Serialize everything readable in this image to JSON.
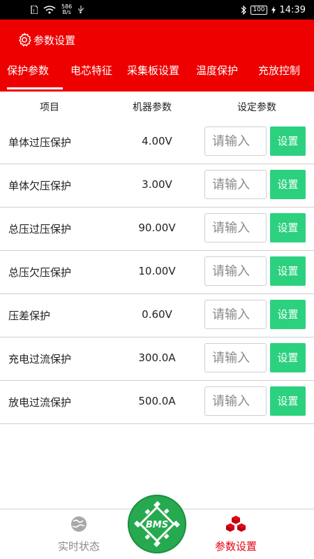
{
  "statusbar": {
    "net_speed_value": "586",
    "net_speed_unit": "B/s",
    "battery": "100",
    "time": "14:39"
  },
  "header": {
    "title": "参数设置",
    "tabs": [
      {
        "label": "保护参数"
      },
      {
        "label": "电芯特征"
      },
      {
        "label": "采集板设置"
      },
      {
        "label": "温度保护"
      },
      {
        "label": "充放控制"
      }
    ]
  },
  "table": {
    "headers": [
      "项目",
      "机器参数",
      "设定参数"
    ],
    "input_placeholder": "请输入",
    "button_label": "设置",
    "rows": [
      {
        "name": "单体过压保护",
        "value": "4.00V"
      },
      {
        "name": "单体欠压保护",
        "value": "3.00V"
      },
      {
        "name": "总压过压保护",
        "value": "90.00V"
      },
      {
        "name": "总压欠压保护",
        "value": "10.00V"
      },
      {
        "name": "压差保护",
        "value": "0.60V"
      },
      {
        "name": "充电过流保护",
        "value": "300.0A"
      },
      {
        "name": "放电过流保护",
        "value": "500.0A"
      }
    ]
  },
  "bottom_nav": {
    "realtime_label": "实时状态",
    "center_logo": "BMS",
    "settings_label": "参数设置",
    "active_color": "#e60012",
    "inactive_color": "#8a8a8a"
  },
  "colors": {
    "header_red": "#ee0000",
    "button_green": "#2bd17e",
    "logo_green": "#27a94f"
  }
}
